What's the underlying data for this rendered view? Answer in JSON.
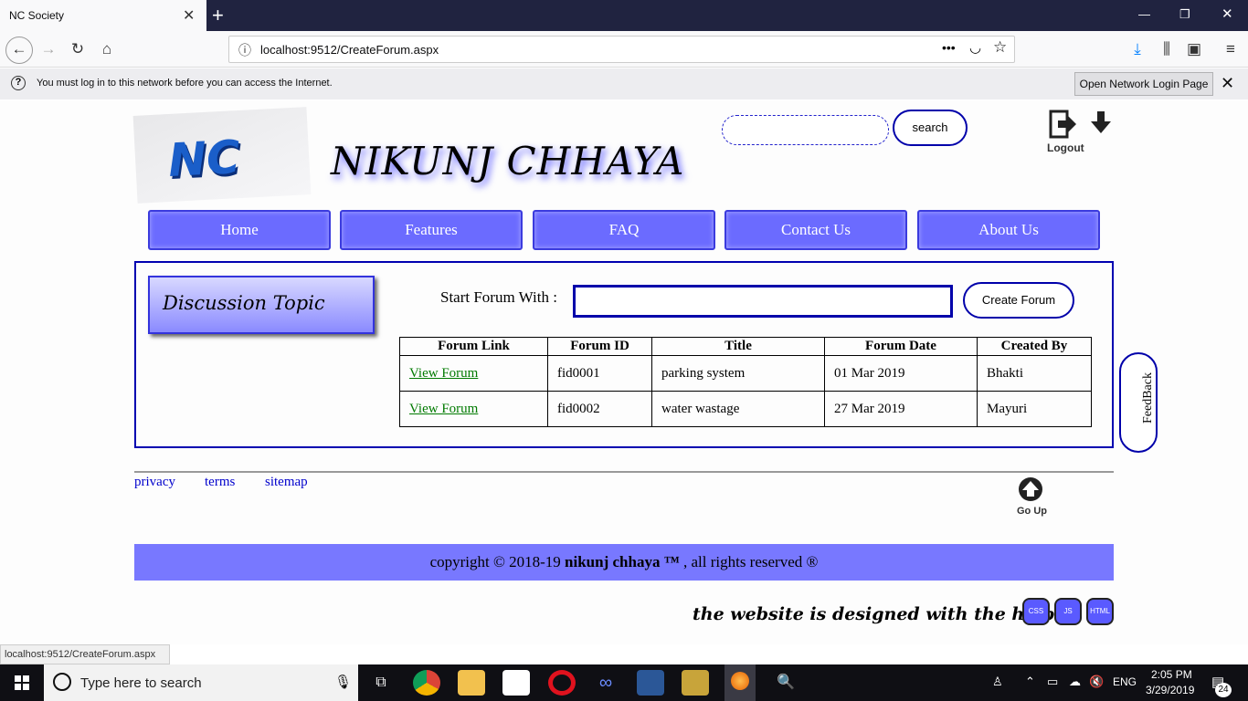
{
  "browser": {
    "tab_title": "NC Society",
    "url": "localhost:9512/CreateForum.aspx",
    "notice_text": "You must log in to this network before you can access the Internet.",
    "notice_button": "Open Network Login Page",
    "status_url": "localhost:9512/CreateForum.aspx"
  },
  "header": {
    "logo_text": "NC",
    "site_title": "NIKUNJ CHHAYA",
    "search_button": "search",
    "logout_label": "Logout"
  },
  "menu": [
    {
      "label": "Home"
    },
    {
      "label": "Features"
    },
    {
      "label": "FAQ"
    },
    {
      "label": "Contact Us"
    },
    {
      "label": "About Us"
    }
  ],
  "main": {
    "discussion_topic": "Discussion Topic",
    "start_label": "Start Forum With :",
    "forum_input_value": "",
    "create_button": "Create Forum",
    "table": {
      "columns": [
        "Forum Link",
        "Forum ID",
        "Title",
        "Forum Date",
        "Created By"
      ],
      "rows": [
        [
          "View Forum",
          "fid0001",
          "parking system",
          "01 Mar 2019",
          "Bhakti"
        ],
        [
          "View Forum",
          "fid0002",
          "water wastage",
          "27 Mar 2019",
          "Mayuri"
        ]
      ]
    },
    "feedback_label": "FeedBack"
  },
  "footer": {
    "links": [
      "privacy",
      "terms",
      "sitemap"
    ],
    "goup_label": "Go Up",
    "copyright_prefix": "copyright © 2018-19 ",
    "copyright_brand": "nikunj chhaya ™",
    "copyright_suffix": " , all rights reserved ®",
    "credit_text": "the website is designed with the help of",
    "badges": [
      "CSS",
      "JS",
      "HTML"
    ]
  },
  "taskbar": {
    "search_placeholder": "Type here to search",
    "time": "2:05 PM",
    "date": "3/29/2019",
    "language": "ENG",
    "notification_count": "24"
  },
  "colors": {
    "accent": "#6b6bff",
    "border_blue": "#0000aa",
    "link_green": "#007a00"
  }
}
